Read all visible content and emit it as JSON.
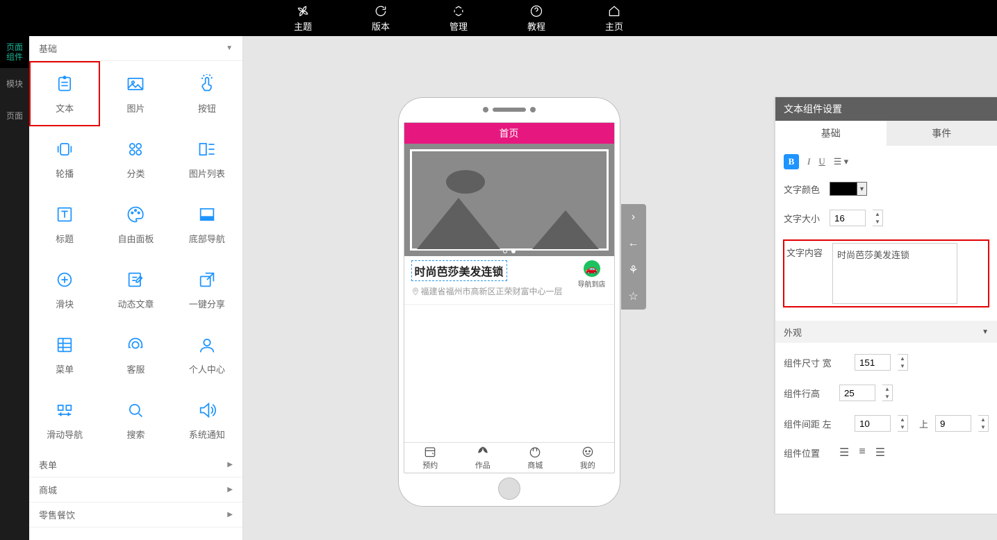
{
  "topnav": {
    "theme": "主题",
    "version": "版本",
    "manage": "管理",
    "tutorial": "教程",
    "home": "主页"
  },
  "rail": {
    "page_components": "页面组件",
    "modules": "模块",
    "pages": "页面"
  },
  "accordions": {
    "basic": "基础",
    "form": "表单",
    "mall": "商城",
    "retail_fnb": "零售餐饮"
  },
  "components": {
    "text": "文本",
    "image": "图片",
    "button": "按钮",
    "carousel": "轮播",
    "category": "分类",
    "image_list": "图片列表",
    "title": "标题",
    "free_panel": "自由面板",
    "bottom_nav": "底部导航",
    "slider": "滑块",
    "dynamic_article": "动态文章",
    "one_click_share": "一键分享",
    "menu": "菜单",
    "service": "客服",
    "profile": "个人中心",
    "sliding_nav": "滑动导航",
    "search": "搜索",
    "system_notice": "系统通知"
  },
  "preview": {
    "page_title": "首页",
    "store_name": "时尚芭莎美发连锁",
    "address": "福建省福州市高新区正荣财富中心一层",
    "nav_to_store": "导航到店",
    "tabs": {
      "booking": "预约",
      "works": "作品",
      "mall": "商城",
      "mine": "我的"
    }
  },
  "props": {
    "panel_title": "文本组件设置",
    "tab_basic": "基础",
    "tab_event": "事件",
    "label_color": "文字颜色",
    "label_size": "文字大小",
    "label_content": "文字内容",
    "size_value": "16",
    "content_value": "时尚芭莎美发连锁",
    "section_appearance": "外观",
    "label_dim_w": "组件尺寸  宽",
    "dim_w": "151",
    "label_line_h": "组件行高",
    "line_h": "25",
    "label_margin": "组件间距  左",
    "margin_l": "10",
    "label_margin_top": "上",
    "margin_t": "9",
    "label_pos": "组件位置"
  }
}
